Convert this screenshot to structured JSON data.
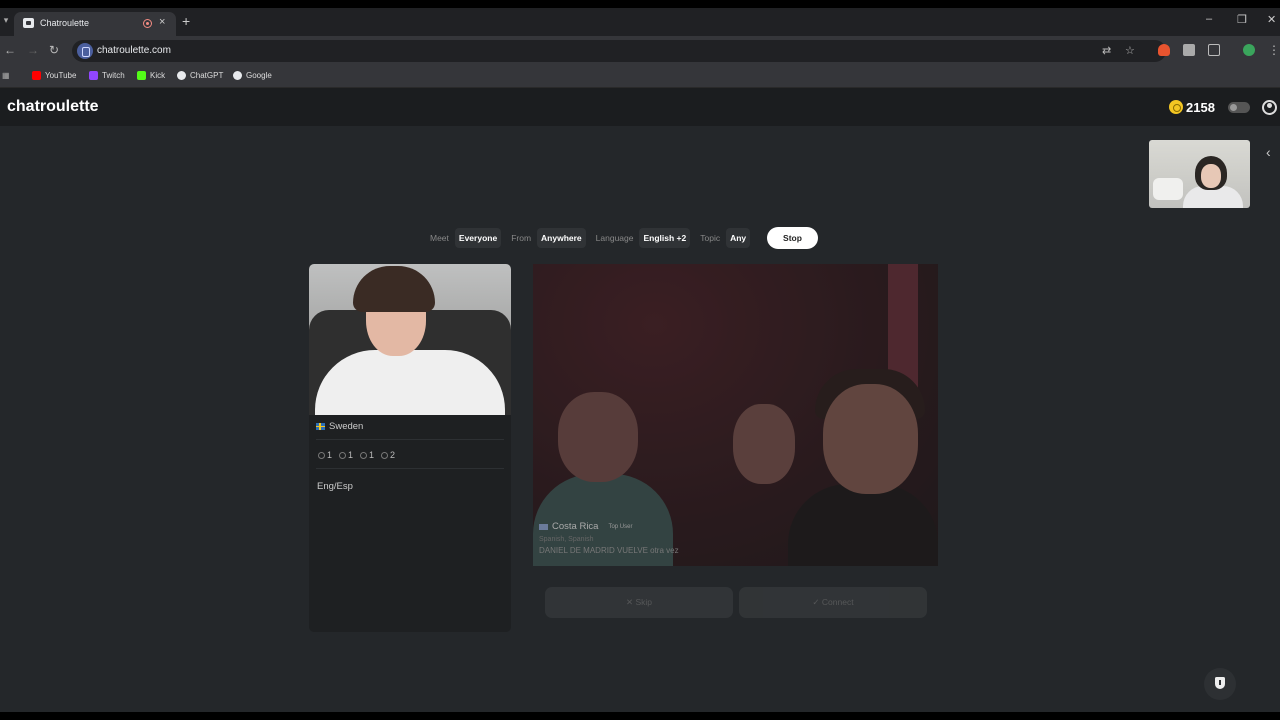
{
  "browser": {
    "tab_title": "Chatroulette",
    "tab_close": "×",
    "new_tab": "+",
    "url": "chatroulette.com",
    "bookmarks": [
      {
        "label": "YouTube",
        "icon": "youtube-icon",
        "color": "#ff0000"
      },
      {
        "label": "Twitch",
        "icon": "twitch-icon",
        "color": "#9146ff"
      },
      {
        "label": "Kick",
        "icon": "kick-icon",
        "color": "#53fc18"
      },
      {
        "label": "ChatGPT",
        "icon": "chatgpt-icon",
        "color": "#e8eaed"
      },
      {
        "label": "Google",
        "icon": "google-icon",
        "color": "#e8eaed"
      }
    ]
  },
  "header": {
    "logo": "chatroulette",
    "coins": "2158"
  },
  "filters": {
    "meet_label": "Meet",
    "meet_value": "Everyone",
    "from_label": "From",
    "from_value": "Anywhere",
    "language_label": "Language",
    "language_value": "English +2",
    "topic_label": "Topic",
    "topic_value": "Any",
    "stop": "Stop"
  },
  "stranger": {
    "country": "Sweden",
    "stats": [
      "1",
      "1",
      "1",
      "2"
    ],
    "bio": "Eng/Esp"
  },
  "remote": {
    "country": "Costa Rica",
    "badge": "Top User",
    "languages": "Spanish, Spanish",
    "bio": "DANIEL DE MADRID VUELVE otra vez"
  },
  "actions": {
    "skip": "✕  Skip",
    "connect": "✓  Connect"
  },
  "colors": {
    "accent_coin": "#f3c623",
    "page_bg": "#24272a",
    "topbar_bg": "#1b1d1f"
  }
}
